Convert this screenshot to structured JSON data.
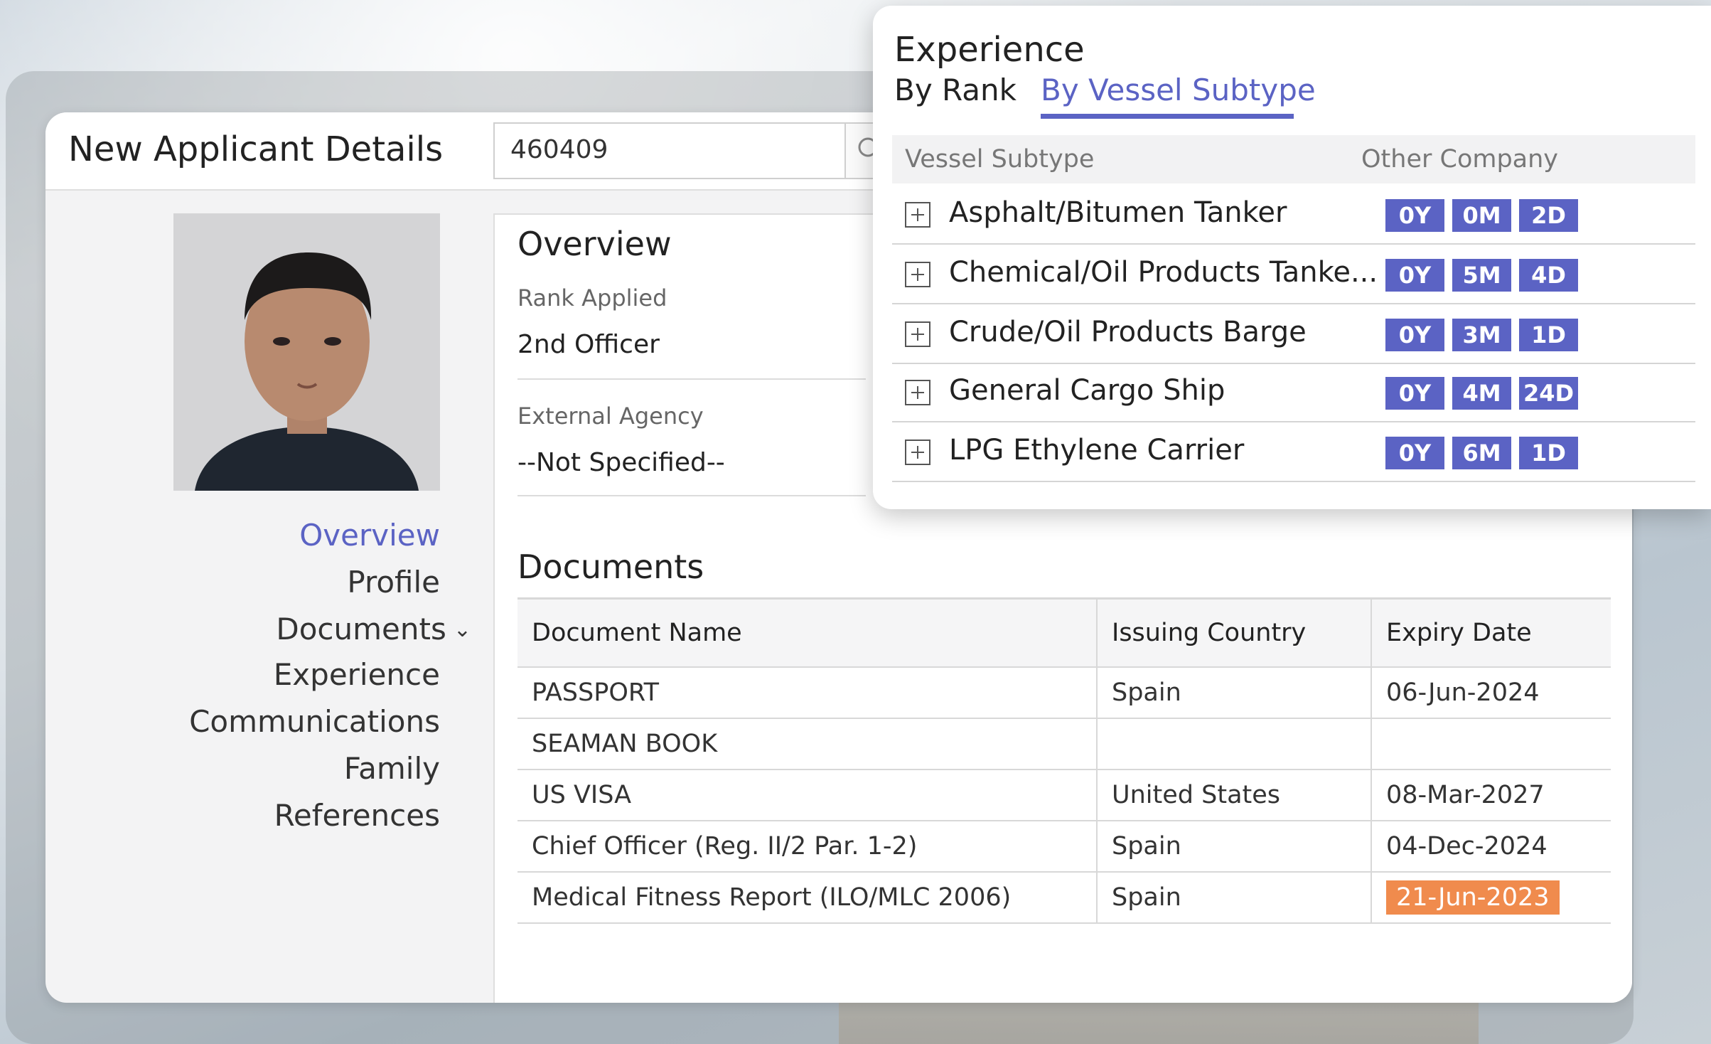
{
  "applicant": {
    "title": "New Applicant Details",
    "search_value": "460409"
  },
  "side_nav": {
    "items": [
      {
        "label": "Overview",
        "active": true
      },
      {
        "label": "Profile"
      },
      {
        "label": "Documents"
      },
      {
        "label": "Experience"
      },
      {
        "label": "Communications"
      },
      {
        "label": "Family"
      },
      {
        "label": "References"
      }
    ]
  },
  "overview": {
    "title": "Overview",
    "rank_label": "Rank Applied",
    "rank_value": "2nd Officer",
    "agency_label": "External Agency",
    "agency_value": "--Not Specified--"
  },
  "documents": {
    "title": "Documents",
    "columns": [
      "Document Name",
      "Issuing Country",
      "Expiry Date"
    ],
    "rows": [
      {
        "name": "PASSPORT",
        "country": "Spain",
        "expiry": "06-Jun-2024"
      },
      {
        "name": "SEAMAN BOOK",
        "country": "",
        "expiry": ""
      },
      {
        "name": "US VISA",
        "country": "United States",
        "expiry": "08-Mar-2027"
      },
      {
        "name": "Chief Officer (Reg. II/2 Par. 1-2)",
        "country": "Spain",
        "expiry": "04-Dec-2024"
      },
      {
        "name": "Medical Fitness Report (ILO/MLC 2006)",
        "country": "Spain",
        "expiry": "21-Jun-2023",
        "expired": true
      }
    ]
  },
  "experience": {
    "title": "Experience",
    "tabs": [
      "By Rank",
      "By Vessel Subtype"
    ],
    "active_tab": "By Vessel Subtype",
    "columns": [
      "Vessel Subtype",
      "Other Company"
    ],
    "rows": [
      {
        "name": "Asphalt/Bitumen Tanker",
        "years": "0Y",
        "months": "0M",
        "days": "2D"
      },
      {
        "name": "Chemical/Oil Products Tanke...",
        "years": "0Y",
        "months": "5M",
        "days": "4D"
      },
      {
        "name": "Crude/Oil Products Barge",
        "years": "0Y",
        "months": "3M",
        "days": "1D"
      },
      {
        "name": "General Cargo Ship",
        "years": "0Y",
        "months": "4M",
        "days": "24D"
      },
      {
        "name": "LPG Ethylene Carrier",
        "years": "0Y",
        "months": "6M",
        "days": "1D"
      }
    ]
  },
  "colors": {
    "accent": "#5b63c4",
    "expired_badge": "#f08b4d"
  },
  "icons": {
    "search": "search-icon",
    "expand": "plus-square-icon",
    "dropdown": "chevron-down-icon"
  }
}
